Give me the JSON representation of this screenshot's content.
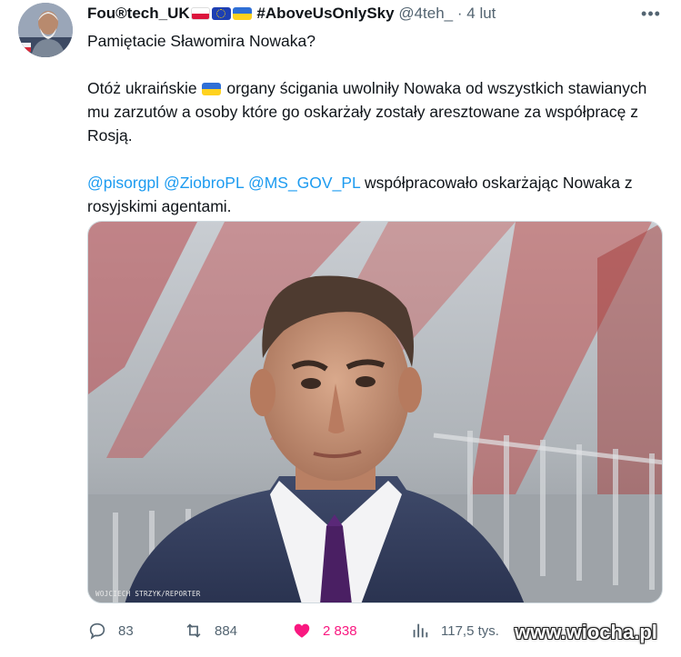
{
  "tweet": {
    "author": {
      "name": "Fou®tech_UK",
      "hashtag": "#AboveUsOnlySky",
      "handle": "@4teh_",
      "separator": "·",
      "time": "4 lut",
      "flags": [
        "poland-flag",
        "eu-flag",
        "ukraine-flag"
      ]
    },
    "more_label": "•••",
    "text": {
      "line1": "Pamiętacie Sławomira Nowaka?",
      "p2_before_flag": "Otóż ukraińskie ",
      "p2_after_flag": " organy ścigania uwolniły Nowaka od wszystkich stawianych mu zarzutów a osoby które go oskarżały zostały aresztowane za współpracę z Rosją.",
      "mention1": "@pisorgpl",
      "mention2": "@ZiobroPL",
      "mention3": "@MS_GOV_PL",
      "p3_rest": " współpracowało oskarżając Nowaka z rosyjskimi agentami."
    },
    "media": {
      "credit": "WOJCIECH STRZYK/REPORTER"
    },
    "actions": {
      "replies": "83",
      "retweets": "884",
      "likes": "2 838",
      "views": "117,5 tys."
    },
    "colors": {
      "link": "#1d9bf0",
      "like": "#f91880",
      "secondary_text": "#536471"
    }
  },
  "watermark": "www.wiocha.pl"
}
